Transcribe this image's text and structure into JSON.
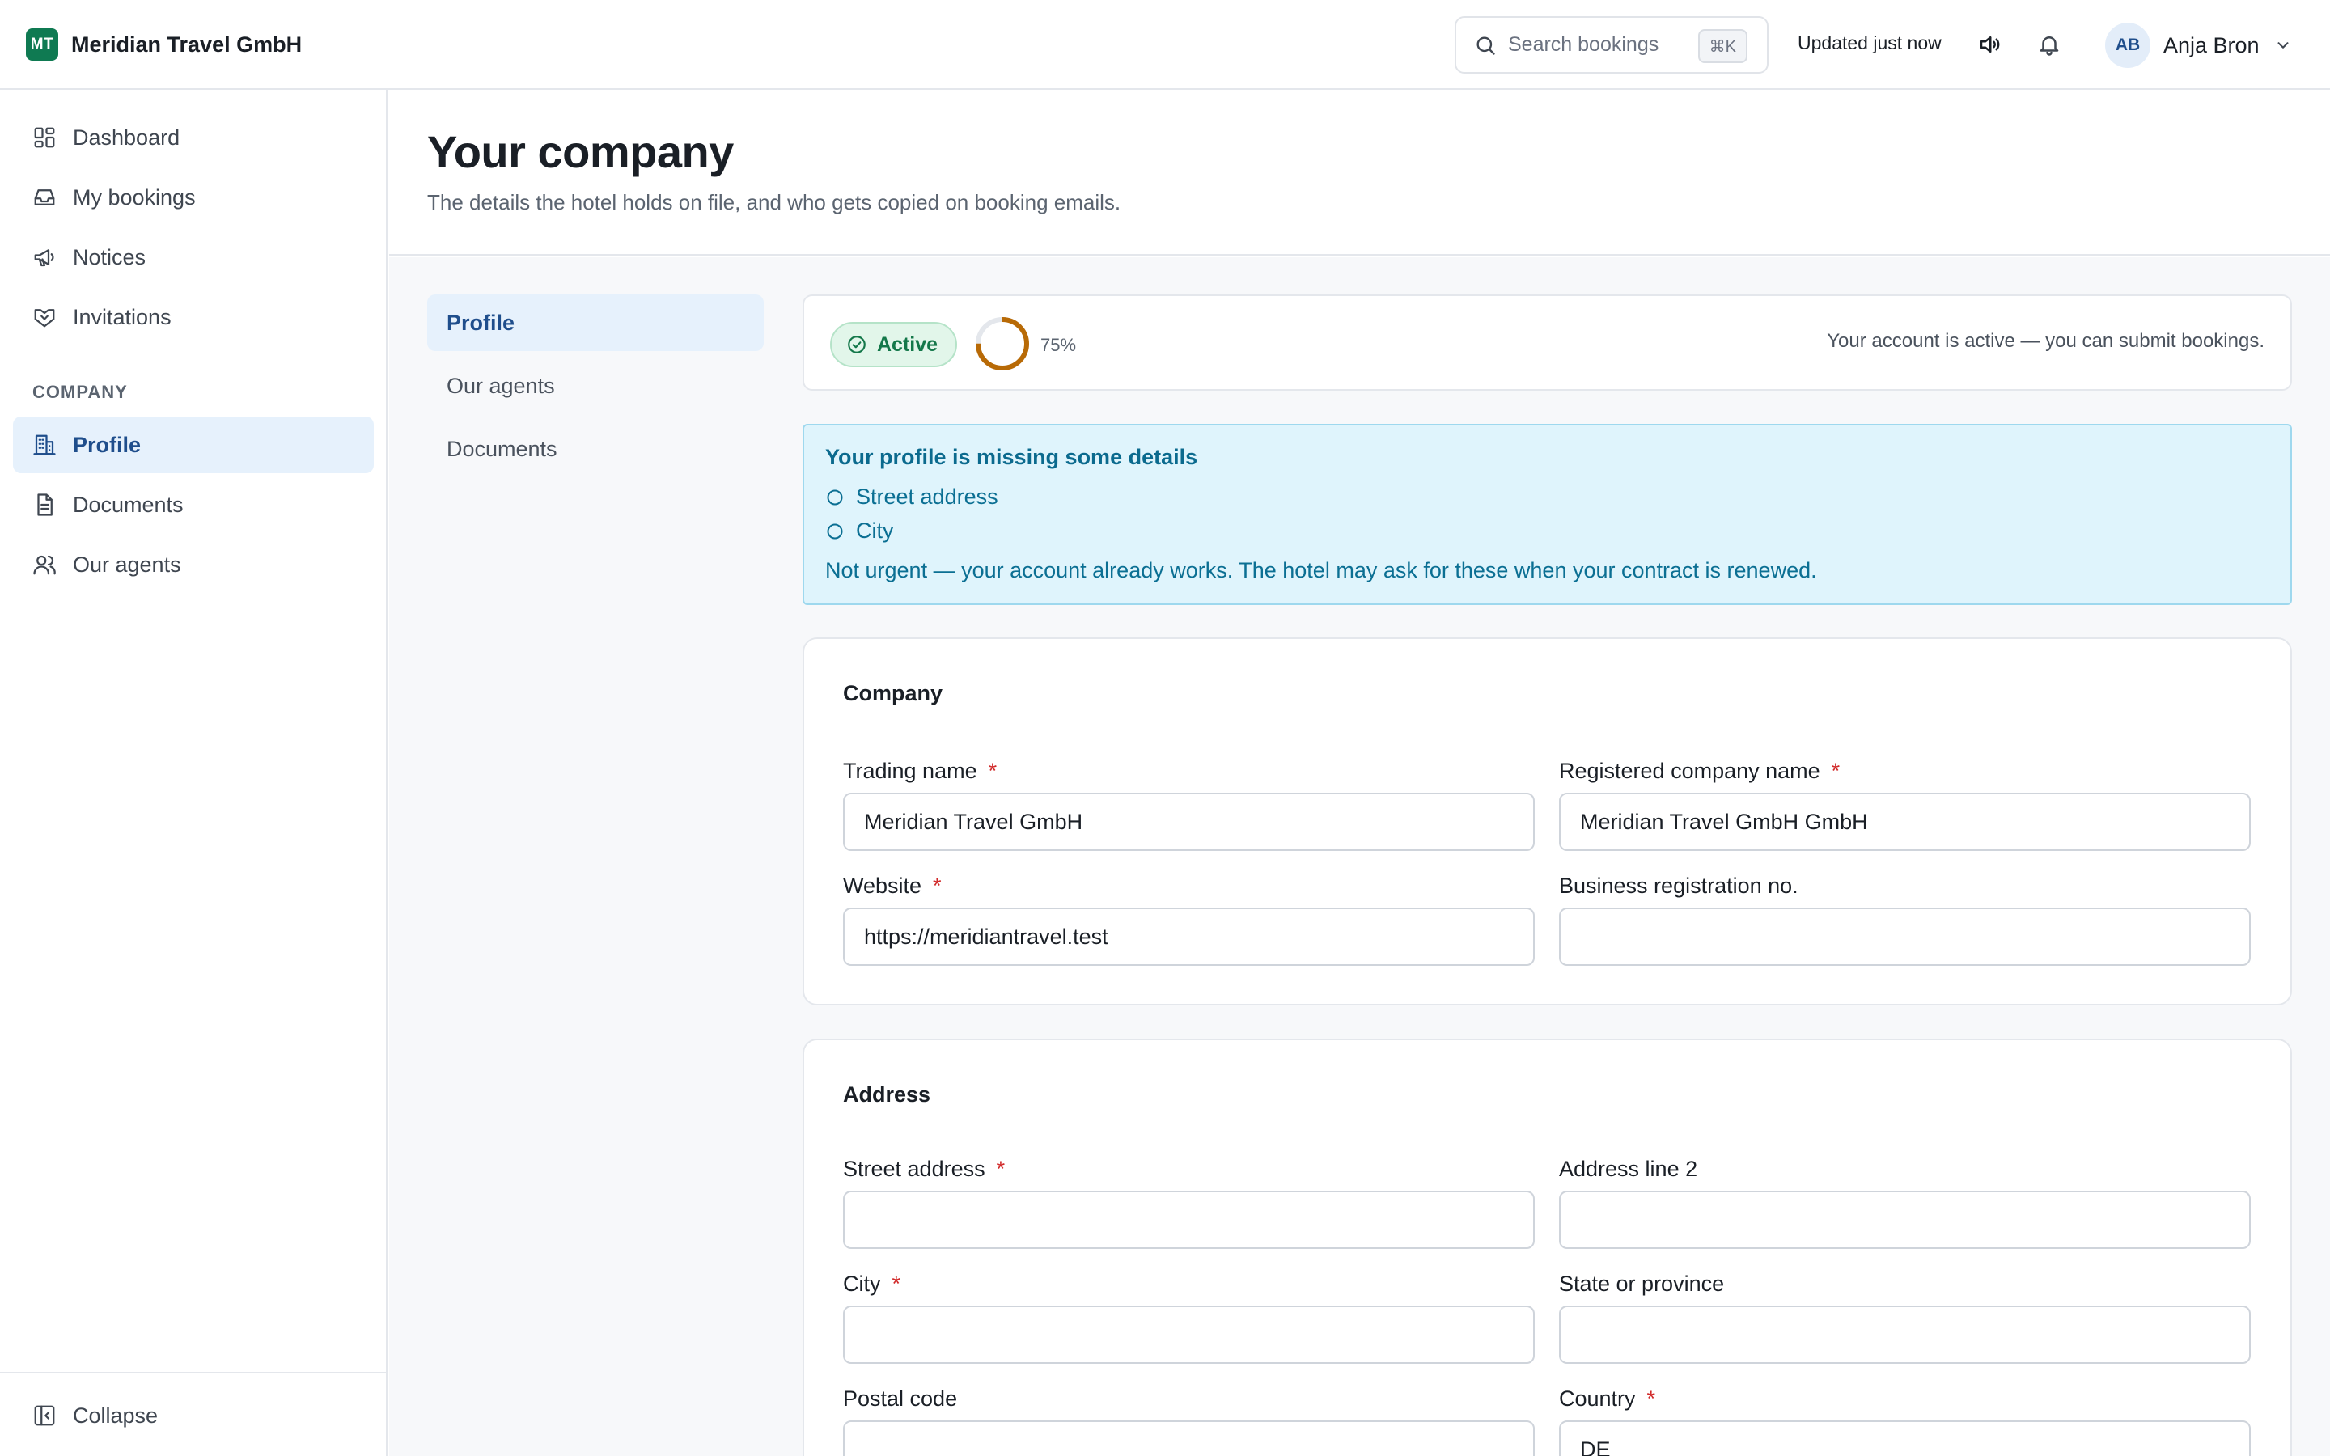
{
  "app": {
    "logo_initials": "MT",
    "company_name": "Meridian Travel GmbH"
  },
  "topbar": {
    "search_placeholder": "Search bookings",
    "search_shortcut": "⌘K",
    "updated_text": "Updated just now",
    "user": {
      "initials": "AB",
      "name": "Anja Bron"
    }
  },
  "sidebar": {
    "main_items": [
      {
        "label": "Dashboard",
        "icon": "dashboard-icon"
      },
      {
        "label": "My bookings",
        "icon": "inbox-icon"
      },
      {
        "label": "Notices",
        "icon": "megaphone-icon"
      },
      {
        "label": "Invitations",
        "icon": "handshake-icon"
      }
    ],
    "section_label": "COMPANY",
    "company_items": [
      {
        "label": "Profile",
        "icon": "building-icon",
        "active": true
      },
      {
        "label": "Documents",
        "icon": "document-icon"
      },
      {
        "label": "Our agents",
        "icon": "users-icon"
      }
    ],
    "collapse_label": "Collapse"
  },
  "page": {
    "title": "Your company",
    "subtitle": "The details the hotel holds on file, and who gets copied on booking emails."
  },
  "subnav": {
    "items": [
      {
        "label": "Profile",
        "active": true
      },
      {
        "label": "Our agents"
      },
      {
        "label": "Documents"
      }
    ]
  },
  "status": {
    "badge_label": "Active",
    "progress_label": "75%",
    "progress_value": 0.75,
    "message": "Your account is active — you can submit bookings.",
    "colors": {
      "badge": "#14784a",
      "progress": "#b86a06"
    }
  },
  "alert": {
    "title": "Your profile is missing some details",
    "items": [
      "Street address",
      "City"
    ],
    "footer": "Not urgent — your account already works. The hotel may ask for these when your contract is renewed."
  },
  "company_card": {
    "title": "Company",
    "fields": {
      "trading_name": {
        "label": "Trading name",
        "value": "Meridian Travel GmbH"
      },
      "registered_name": {
        "label": "Registered company name",
        "value": "Meridian Travel GmbH GmbH"
      },
      "website": {
        "label": "Website",
        "value": "https://meridiantravel.test"
      },
      "registration_no": {
        "label": "Business registration no.",
        "value": ""
      }
    }
  },
  "address_card": {
    "title": "Address",
    "fields": {
      "street": {
        "label": "Street address",
        "value": ""
      },
      "line2": {
        "label": "Address line 2",
        "value": ""
      },
      "city": {
        "label": "City",
        "value": ""
      },
      "state": {
        "label": "State or province",
        "value": ""
      },
      "postal": {
        "label": "Postal code",
        "value": ""
      },
      "country": {
        "label": "Country",
        "value": "DE"
      }
    }
  },
  "required_marker": "*"
}
